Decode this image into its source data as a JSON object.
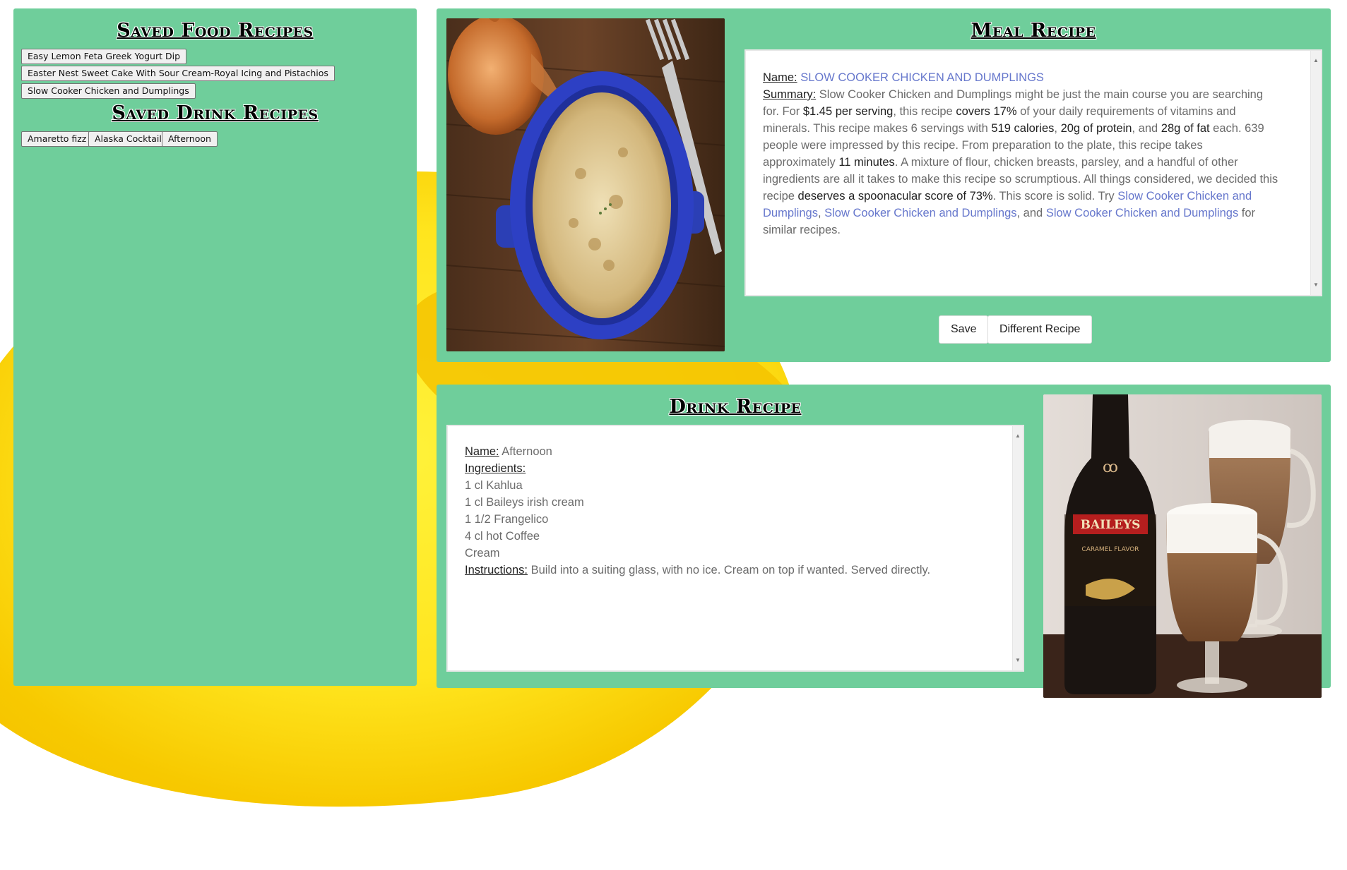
{
  "saved": {
    "food_title": "Saved Food Recipes",
    "food_items": [
      "Easy Lemon Feta Greek Yogurt Dip",
      "Easter Nest Sweet Cake With Sour Cream-Royal Icing and Pistachios",
      "Slow Cooker Chicken and Dumplings"
    ],
    "drink_title": "Saved Drink Recipes",
    "drink_items": [
      "Amaretto fizz",
      "Alaska Cocktail",
      "Afternoon"
    ]
  },
  "meal": {
    "title": "Meal Recipe",
    "name_label": "Name:",
    "name": "SLOW COOKER CHICKEN AND DUMPLINGS",
    "summary_label": "Summary:",
    "summary": {
      "t1": "Slow Cooker Chicken and Dumplings might be just the main course you are searching for. For ",
      "b1": "$1.45 per serving",
      "t2": ", this recipe ",
      "b2": "covers 17%",
      "t3": " of your daily requirements of vitamins and minerals. This recipe makes 6 servings with ",
      "b3": "519 calories",
      "t4": ", ",
      "b4": "20g of protein",
      "t5": ", and ",
      "b5": "28g of fat",
      "t6": " each. 639 people were impressed by this recipe. From preparation to the plate, this recipe takes approximately ",
      "b6": "11 minutes",
      "t7": ". A mixture of flour, chicken breasts, parsley, and a handful of other ingredients are all it takes to make this recipe so scrumptious. All things considered, we decided this recipe ",
      "b7": "deserves a spoonacular score of 73%",
      "t8": ". This score is solid. Try ",
      "l1": "Slow Cooker Chicken and Dumplings",
      "t9": ", ",
      "l2": "Slow Cooker Chicken and Dumplings",
      "t10": ", and ",
      "l3": "Slow Cooker Chicken and Dumplings",
      "t11": " for similar recipes."
    },
    "save_label": "Save",
    "different_label": "Different Recipe"
  },
  "drink": {
    "title": "Drink Recipe",
    "name_label": "Name:",
    "name": "Afternoon",
    "ingredients_label": "Ingredients:",
    "ingredients": [
      "1 cl Kahlua",
      "1 cl Baileys irish cream",
      "1 1/2 Frangelico",
      "4 cl hot Coffee",
      "Cream"
    ],
    "instructions_label": "Instructions:",
    "instructions": "Build into a suiting glass, with no ice. Cream on top if wanted. Served directly.",
    "bottle_brand": "BAILEYS",
    "bottle_flavor": "CARAMEL FLAVOR"
  },
  "colors": {
    "panel": "#6fce9b",
    "link": "#6677cc",
    "yellow": "#ffe51e"
  }
}
